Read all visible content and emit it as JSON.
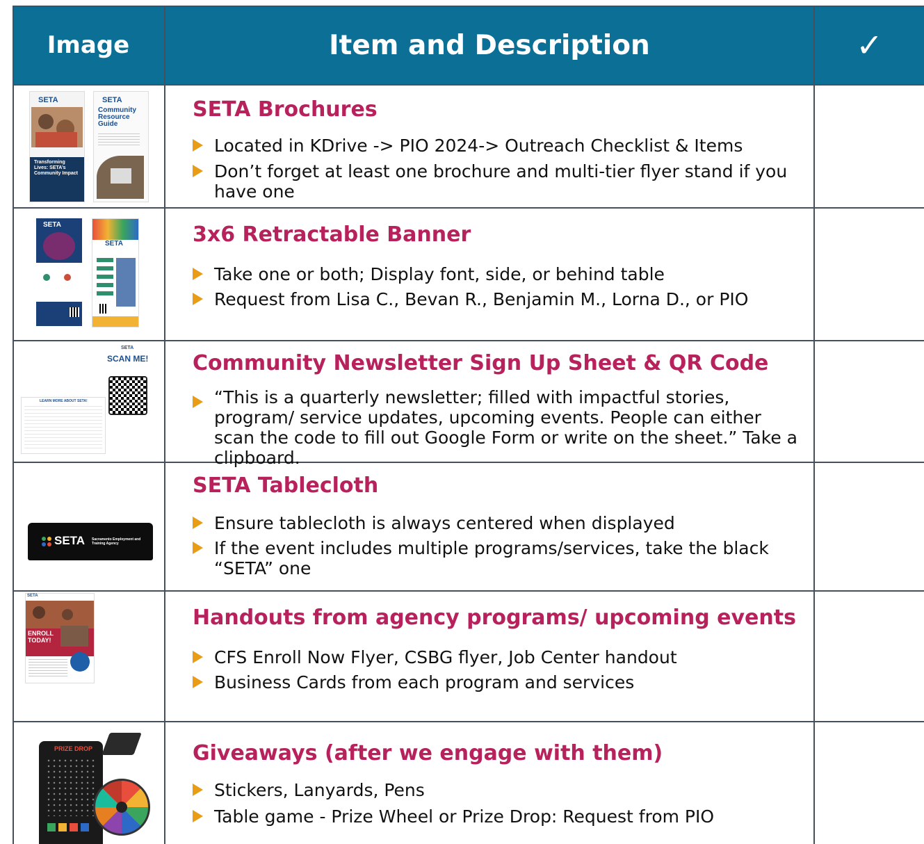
{
  "header": {
    "image_label": "Image",
    "item_label": "Item and Description",
    "check_label": "✓"
  },
  "rows": [
    {
      "title": "SETA Brochures",
      "bullets": [
        "Located in KDrive -> PIO 2024-> Outreach Checklist & Items",
        "Don’t forget at least  one brochure and multi-tier flyer stand if you have one"
      ],
      "thumb": {
        "logo": "SETA",
        "card_title": "Community Resource Guide",
        "caption": "Transforming Lives: SETA’s Community Impact"
      }
    },
    {
      "title": "3x6 Retractable Banner",
      "bullets": [
        "Take one or both; Display font, side, or behind table",
        "Request from Lisa C., Bevan R., Benjamin M., Lorna D., or PIO"
      ],
      "thumb": {
        "logo": "SETA"
      }
    },
    {
      "title": "Community Newsletter Sign Up Sheet & QR Code",
      "bullets": [
        "“This is a quarterly newsletter; filled with impactful stories, program/ service updates, upcoming events. People can either scan the code to fill out Google Form or write on the sheet.” Take a clipboard."
      ],
      "thumb": {
        "logo": "SETA",
        "scan": "SCAN ME!",
        "sheet_title": "LEARN MORE ABOUT SETA!"
      }
    },
    {
      "title": "SETA Tablecloth",
      "bullets": [
        "Ensure tablecloth is always centered when displayed",
        "If the event includes multiple programs/services, take the black “SETA” one"
      ],
      "thumb": {
        "logo": "SETA",
        "agency": "Sacramento Employment and Training Agency"
      }
    },
    {
      "title": "Handouts from agency programs/ upcoming events",
      "bullets": [
        "CFS Enroll Now Flyer, CSBG flyer, Job Center handout",
        "Business Cards from each program and services"
      ],
      "thumb": {
        "logo": "SETA",
        "enroll": "ENROLL TODAY!"
      }
    },
    {
      "title": "Giveaways (after we engage with them)",
      "bullets": [
        "Stickers, Lanyards, Pens",
        "Table game - Prize Wheel or Prize Drop: Request from PIO"
      ],
      "thumb": {
        "prize": "PRIZE DROP"
      }
    }
  ],
  "colors": {
    "header_bg": "#0b6f96",
    "title": "#b8225c",
    "arrow": "#e99d17",
    "grid": "#45505c"
  }
}
